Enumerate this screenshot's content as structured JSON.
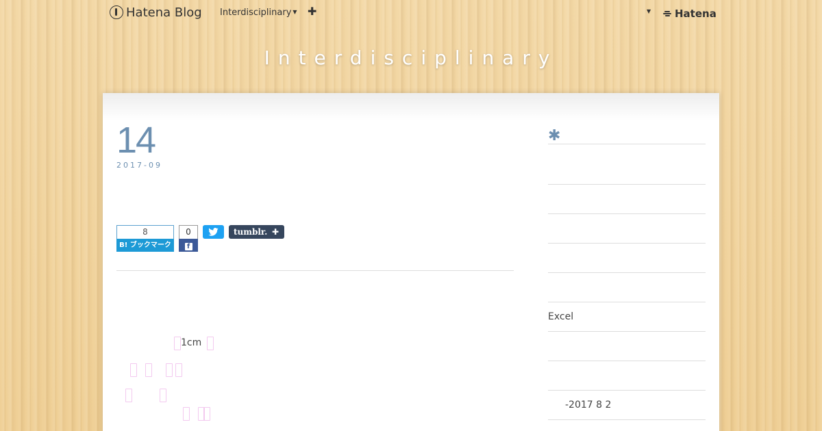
{
  "global_header": {
    "logo_text": "Hatena Blog",
    "blog_name": "Interdisciplinary",
    "brand_text": "Hatena"
  },
  "blog": {
    "title": "Interdisciplinary"
  },
  "entry": {
    "day": "14",
    "year_month": "2017-09",
    "share": {
      "hatena_bookmark_count": "8",
      "hatena_bookmark_label": "B! ブックマーク",
      "facebook_count": "0",
      "tumblr_label": "tumblr."
    },
    "body_lines": [
      {
        "text": "1cm"
      }
    ]
  },
  "sidebar": {
    "rows": [
      "",
      "",
      "",
      "",
      "",
      "Excel",
      "",
      "",
      "-2017 8 2"
    ]
  },
  "colors": {
    "accent": "#6c8fb0",
    "hatena_bookmark": "#1d9ad6",
    "facebook": "#3b5998",
    "twitter": "#1da1f2",
    "tumblr": "#36465d"
  }
}
